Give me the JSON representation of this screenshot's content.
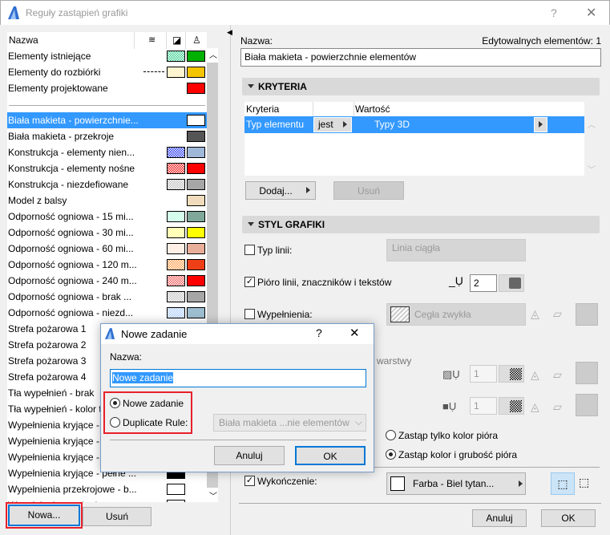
{
  "window": {
    "title": "Reguły zastąpień grafiki",
    "help": "?",
    "close": "✕"
  },
  "list": {
    "header": {
      "name": "Nazwa",
      "col_icons": [
        "line-type-icon",
        "fill-icon",
        "surface-brush-icon"
      ]
    },
    "fixed": [
      {
        "label": "Elementy istniejące",
        "line": "",
        "fill": "#33cc88",
        "pen": "#00b000"
      },
      {
        "label": "Elementy do rozbiórki",
        "line": "dashed",
        "fill": "#ffe9a0",
        "pen": "#f5c400"
      },
      {
        "label": "Elementy projektowane",
        "line": "",
        "fill": "",
        "pen": "#ff0000"
      }
    ],
    "items": [
      {
        "label": "Biała makieta - powierzchnie...",
        "fill": "",
        "pen": "#ffffff",
        "selected": true
      },
      {
        "label": "Biała makieta - przekroje",
        "fill": "",
        "pen": "#555555"
      },
      {
        "label": "Konstrukcja - elementy nien...",
        "fill": "#2233ee",
        "pen": "#a0b8d8"
      },
      {
        "label": "Konstrukcja - elementy nośne",
        "fill": "#ee1111",
        "pen": "#ff0000"
      },
      {
        "label": "Konstrukcja - niezdefiowane",
        "fill": "#bbbbbb",
        "pen": "#a6a6a6"
      },
      {
        "label": "Model z balsy",
        "fill": "",
        "pen": "#f0dcbc"
      },
      {
        "label": "Odporność ogniowa -  15 mi...",
        "fill": "#aaffd8",
        "pen": "#7fa89a"
      },
      {
        "label": "Odporność ogniowa -  30 mi...",
        "fill": "#ffff70",
        "pen": "#ffff00"
      },
      {
        "label": "Odporność ogniowa -  60 mi...",
        "fill": "#ffe0cc",
        "pen": "#e8ae9a"
      },
      {
        "label": "Odporność ogniowa - 120 m...",
        "fill": "#ff9944",
        "pen": "#ee3f17"
      },
      {
        "label": "Odporność ogniowa - 240 m...",
        "fill": "#ee5555",
        "pen": "#ff0000"
      },
      {
        "label": "Odporność ogniowa - brak ...",
        "fill": "#c0c0c0",
        "pen": "#a6a6a6"
      },
      {
        "label": "Odporność ogniowa - niezd...",
        "fill": "#aaccff",
        "pen": "#9dbdd0"
      },
      {
        "label": "Strefa pożarowa 1",
        "fill": "",
        "pen": ""
      },
      {
        "label": "Strefa pożarowa 2",
        "fill": "",
        "pen": ""
      },
      {
        "label": "Strefa pożarowa 3",
        "fill": "",
        "pen": ""
      },
      {
        "label": "Strefa pożarowa 4",
        "fill": "",
        "pen": ""
      },
      {
        "label": "Tła wypełnień - brak",
        "fill": "",
        "pen": ""
      },
      {
        "label": "Tła wypełnień - kolor t...",
        "fill": "",
        "pen": ""
      },
      {
        "label": "Wypełnienia kryjące - b...",
        "fill": "",
        "pen": ""
      },
      {
        "label": "Wypełnienia kryjące - j...",
        "fill": "",
        "pen": ""
      },
      {
        "label": "Wypełnienia kryjące - p...",
        "fill": "",
        "pen": ""
      },
      {
        "label": "Wypełnienia kryjące - pełne ...",
        "fill": "#000000",
        "pen": ""
      },
      {
        "label": "Wypełnienia przekrojowe - b...",
        "fill": "#ffffff",
        "pen": ""
      },
      {
        "label": "Wypełnienia przekrojowe - ...",
        "fill": "#ffffff",
        "pen": ""
      }
    ],
    "new_button": "Nowa...",
    "delete_button": "Usuń"
  },
  "detail": {
    "name_label": "Nazwa:",
    "editable": "Edytowalnych elementów: 1",
    "name_value": "Biała makieta - powierzchnie elementów",
    "criteria": {
      "title": "KRYTERIA",
      "col_criteria": "Kryteria",
      "col_value": "Wartość",
      "rows": [
        {
          "criterion": "Typ elementu",
          "operator": "jest",
          "value": "Typy 3D"
        }
      ],
      "add": "Dodaj...",
      "remove": "Usuń"
    },
    "style": {
      "title": "STYL GRAFIKI",
      "line_type": {
        "label": "Typ linii:",
        "checked": false,
        "value": "Linia ciągła"
      },
      "pen": {
        "label": "Pióro linii, znaczników i tekstów",
        "checked": true,
        "value": "2"
      },
      "fill": {
        "label": "Wypełnienia:",
        "checked": false,
        "value": "Cegła zwykła"
      },
      "layers_fragment": "warstwy",
      "fg_pen": "1",
      "bg_pen": "1",
      "radio_color_only": "Zastąp tylko kolor pióra",
      "radio_color_weight": "Zastąp kolor i grubość pióra",
      "surface": {
        "label": "Wykończenie:",
        "checked": true,
        "value": "Farba - Biel tytan..."
      }
    },
    "cancel": "Anuluj",
    "ok": "OK"
  },
  "dialog": {
    "title": "Nowe zadanie",
    "help": "?",
    "close": "✕",
    "name_label": "Nazwa:",
    "name_value": "Nowe zadanie",
    "radio_new": "Nowe zadanie",
    "radio_duplicate": "Duplicate Rule:",
    "duplicate_source": "Biała makieta ...nie elementów",
    "cancel": "Anuluj",
    "ok": "OK",
    "selected_option": "Nowe zadanie"
  },
  "colors": {
    "accent": "#3399ff",
    "highlight_box": "#e8202a"
  }
}
